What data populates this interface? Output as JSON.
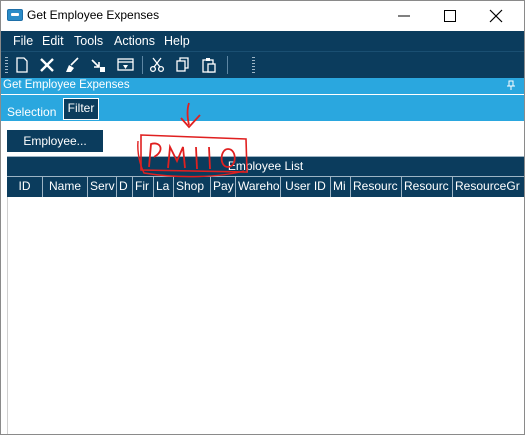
{
  "window": {
    "title": "Get Employee Expenses"
  },
  "menu": {
    "items": [
      "File",
      "Edit",
      "Tools",
      "Actions",
      "Help"
    ]
  },
  "toolbar": {
    "buttons": [
      "new-icon",
      "delete-icon",
      "clear-icon",
      "refresh-icon",
      "customize-icon",
      "cut-icon",
      "copy-icon",
      "paste-icon"
    ]
  },
  "panel": {
    "title": "Get Employee Expenses"
  },
  "tabs": {
    "selection": "Selection",
    "filter": "Filter",
    "active": "Filter"
  },
  "filter": {
    "employee_button": "Employee...",
    "grid_caption": "Employee List",
    "columns": [
      "ID",
      "Name",
      "Serv",
      "D",
      "Fir",
      "La",
      "Shop",
      "Pay",
      "Wareho",
      "User ID",
      "Mi",
      "Resourc",
      "Resourc",
      "ResourceGr"
    ],
    "rows": []
  },
  "annotation": {
    "text": "PM110",
    "color": "#e02020"
  }
}
